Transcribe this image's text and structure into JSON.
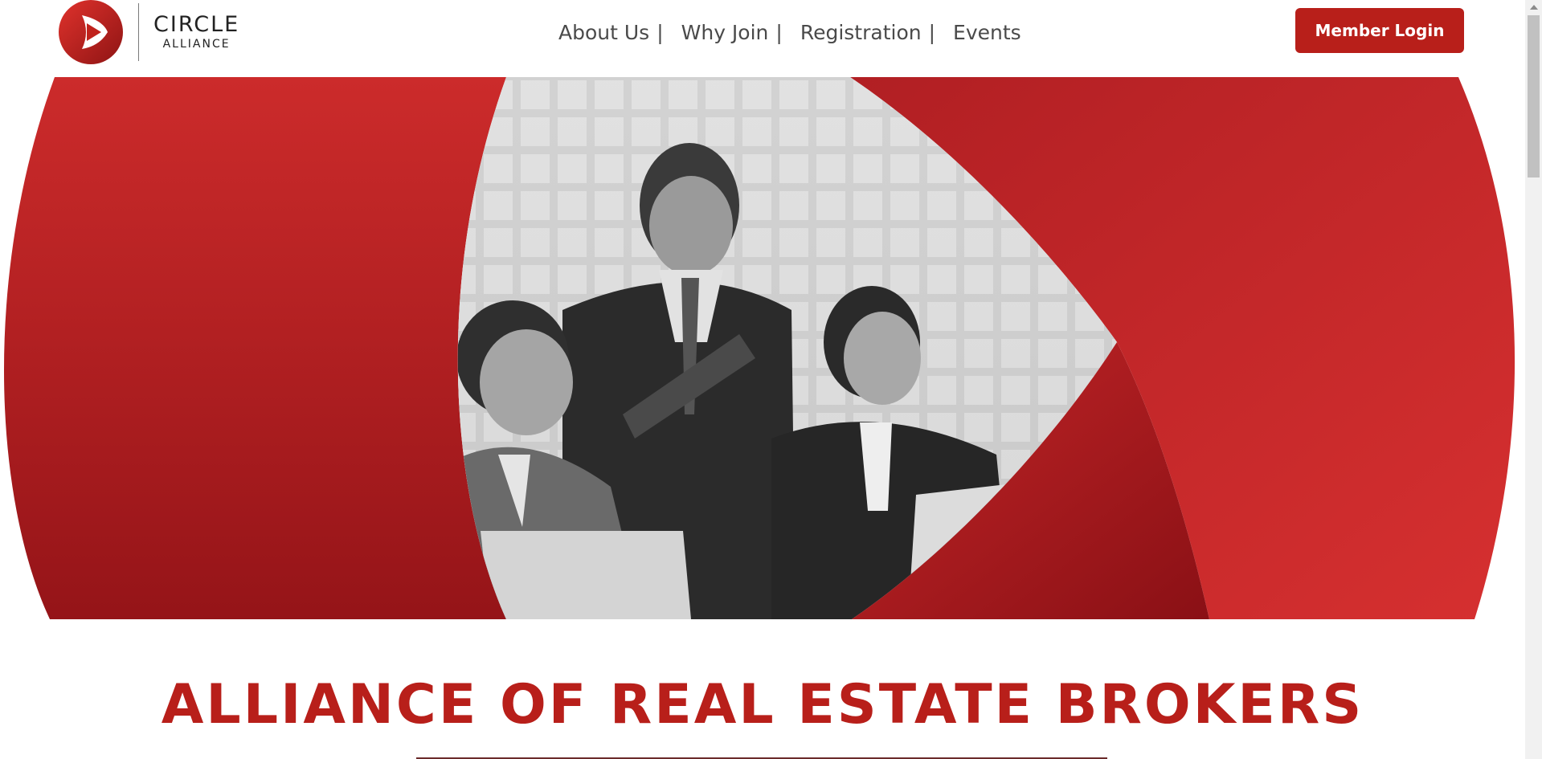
{
  "brand": {
    "name_line1": "CIRCLE",
    "name_line2": "ALLIANCE",
    "color_primary": "#b81f1a"
  },
  "nav": {
    "items": [
      {
        "label": "About Us"
      },
      {
        "label": "Why Join"
      },
      {
        "label": "Registration"
      },
      {
        "label": "Events"
      }
    ],
    "separator": "|"
  },
  "header": {
    "login_label": "Member Login"
  },
  "hero": {
    "image_desc_icon": "business-team-photo"
  },
  "main": {
    "headline": "ALLIANCE OF REAL ESTATE BROKERS"
  }
}
